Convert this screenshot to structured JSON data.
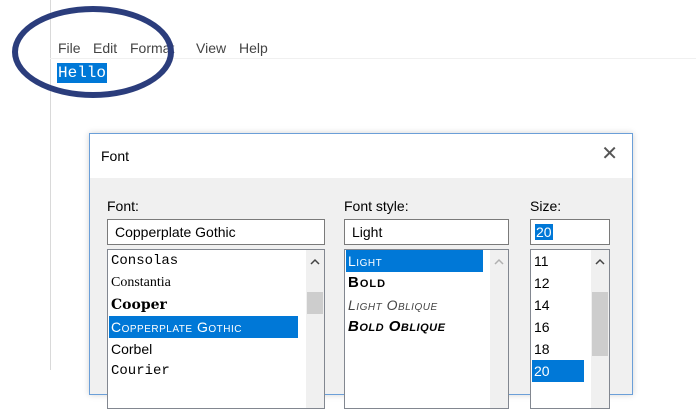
{
  "menu": [
    "File",
    "Edit",
    "Format",
    "View",
    "Help"
  ],
  "editor": {
    "text": "Hello"
  },
  "dialog": {
    "title": "Font",
    "close_glyph": "✕",
    "font": {
      "label": "Font:",
      "value": "Copperplate Gothic",
      "items": [
        "Consolas",
        "Constantia",
        "Cooper",
        "Copperplate Gothic",
        "Corbel",
        "Courier"
      ],
      "selected": "Copperplate Gothic"
    },
    "style": {
      "label": "Font style:",
      "value": "Light",
      "items": [
        "Light",
        "Bold",
        "Light Oblique",
        "Bold Oblique"
      ],
      "selected": "Light"
    },
    "size": {
      "label": "Size:",
      "value": "20",
      "items": [
        "11",
        "12",
        "14",
        "16",
        "18",
        "20"
      ],
      "selected": "20"
    }
  },
  "colors": {
    "selection": "#0078d7",
    "annotation": "#2b3d7c",
    "dialog_border": "#6b9fd8"
  },
  "icons": {
    "close": "close-icon",
    "scroll_up": "chevron-up-icon"
  }
}
